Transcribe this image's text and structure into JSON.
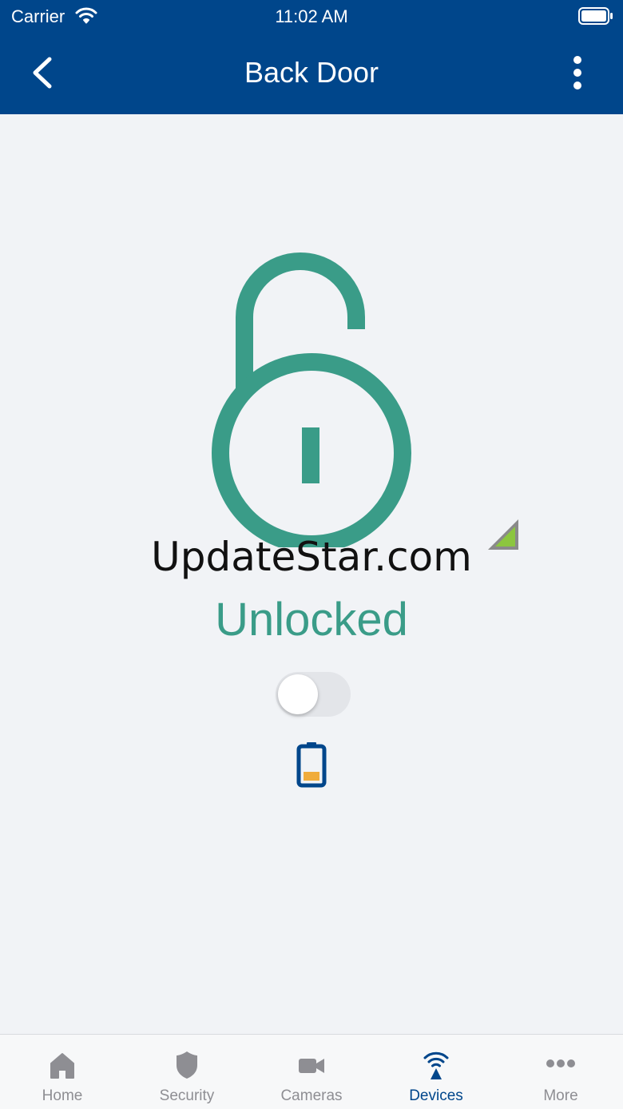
{
  "status_bar": {
    "carrier": "Carrier",
    "time": "11:02 AM"
  },
  "header": {
    "title": "Back Door",
    "background_color": "#00468b"
  },
  "lock": {
    "icon": "padlock-open-icon",
    "watermark": "UpdateStar.com",
    "status": "Unlocked",
    "status_color": "#3a9c88",
    "toggle_on": false,
    "signal_icon": "signal-strength-icon",
    "battery_icon": "battery-low-icon"
  },
  "tabs": [
    {
      "label": "Home",
      "icon": "home-icon",
      "active": false
    },
    {
      "label": "Security",
      "icon": "shield-icon",
      "active": false
    },
    {
      "label": "Cameras",
      "icon": "video-camera-icon",
      "active": false
    },
    {
      "label": "Devices",
      "icon": "devices-wireless-icon",
      "active": true
    },
    {
      "label": "More",
      "icon": "more-dots-icon",
      "active": false
    }
  ]
}
